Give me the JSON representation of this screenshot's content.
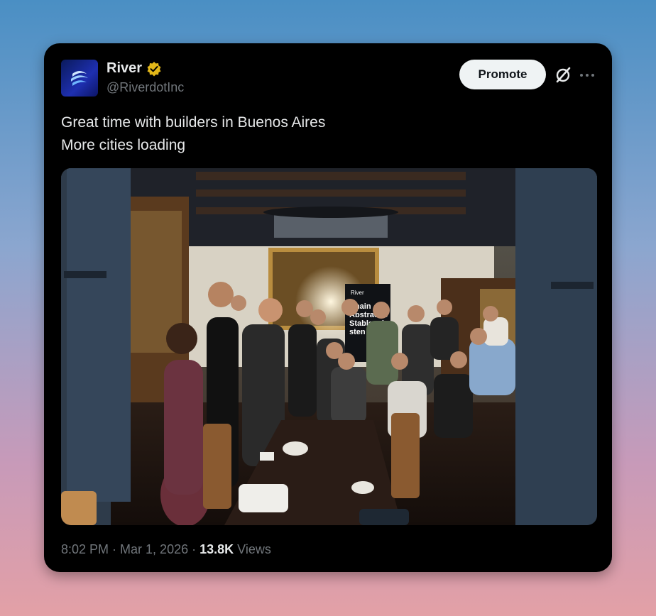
{
  "post": {
    "author_name": "River",
    "author_handle": "@RiverdotInc",
    "promote_label": "Promote",
    "text_line1": "Great time with builders in Buenos Aires",
    "text_line2": "More cities loading",
    "time": "8:02 PM",
    "separator1": " · ",
    "date": "Mar 1, 2026",
    "separator2": " · ",
    "views_count": "13.8K",
    "views_label": " Views"
  },
  "photo": {
    "banner_lines": [
      "Chain",
      "Abstractio",
      "Stablecoi",
      "sten"
    ],
    "banner_logo": "River"
  },
  "icons": {
    "verified": "verified-badge-icon",
    "grok": "grok-icon",
    "more": "more-icon",
    "avatar_logo": "river-logo-icon"
  },
  "colors": {
    "background": "#000000",
    "text": "#e7e9ea",
    "muted": "#71767b",
    "promote_bg": "#eff3f4",
    "verified": "#e2b719"
  }
}
